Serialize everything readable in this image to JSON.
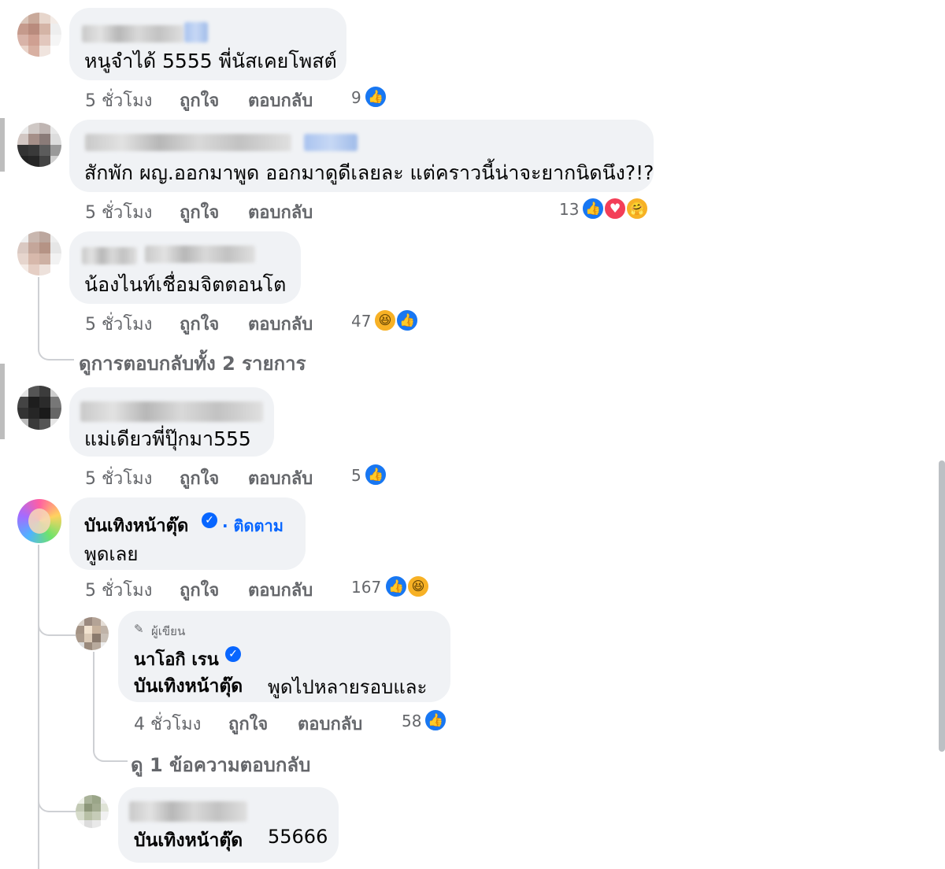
{
  "comments": [
    {
      "text": "หนูจำได้ 5555 พี่นัสเคยโพสต์",
      "time": "5 ชั่วโมง",
      "like": "ถูกใจ",
      "reply": "ตอบกลับ",
      "reaction_count": "9",
      "reactions": [
        "like"
      ]
    },
    {
      "text": "สักพัก ผญ.ออกมาพูด ออกมาดูดีเลยละ แต่คราวนี้น่าจะยากนิดนึง?!?",
      "time": "5 ชั่วโมง",
      "like": "ถูกใจ",
      "reply": "ตอบกลับ",
      "reaction_count": "13",
      "reactions": [
        "like",
        "love",
        "care"
      ]
    },
    {
      "text": "น้องไนท์เชื่อมจิตตอนโต",
      "time": "5 ชั่วโมง",
      "like": "ถูกใจ",
      "reply": "ตอบกลับ",
      "reaction_count": "47",
      "reactions": [
        "haha",
        "like"
      ],
      "view_replies": "ดูการตอบกลับทั้ง 2 รายการ"
    },
    {
      "text": "แม่เดียวพี่ปุ๊กมา555",
      "time": "5 ชั่วโมง",
      "like": "ถูกใจ",
      "reply": "ตอบกลับ",
      "reaction_count": "5",
      "reactions": [
        "like"
      ]
    },
    {
      "author": "บันเทิงหน้าตุ๊ด",
      "follow": "· ติดตาม",
      "text": "พูดเลย",
      "time": "5 ชั่วโมง",
      "like": "ถูกใจ",
      "reply": "ตอบกลับ",
      "reaction_count": "167",
      "reactions": [
        "like",
        "haha"
      ]
    }
  ],
  "replies": [
    {
      "author_tag": "ผู้เขียน",
      "author": "นาโอกิ เรน",
      "mention": "บันเทิงหน้าตุ๊ด",
      "text": "พูดไปหลายรอบและ",
      "time": "4 ชั่วโมง",
      "like": "ถูกใจ",
      "reply": "ตอบกลับ",
      "reaction_count": "58",
      "reactions": [
        "like"
      ],
      "view_replies": "ดู 1 ข้อความตอบกลับ"
    },
    {
      "mention": "บันเทิงหน้าตุ๊ด",
      "text": "55666"
    }
  ],
  "icons": {
    "like": "👍",
    "love": "♥",
    "haha": "😆",
    "care": "🤗",
    "pen": "✎",
    "check": "✓"
  },
  "colors": {
    "link": "#0866ff",
    "bubble": "#f0f2f5",
    "muted": "#65676b",
    "like": "#1877f2"
  }
}
